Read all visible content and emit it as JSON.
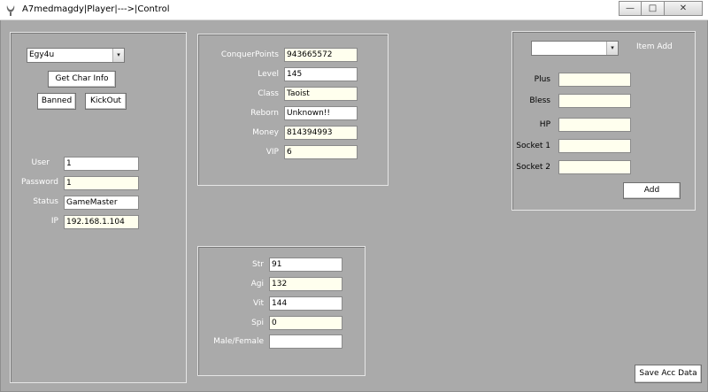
{
  "window": {
    "title": "A7medmagdy|Player|--->|Control",
    "minimize_glyph": "—",
    "maximize_glyph": "□",
    "close_glyph": "✕"
  },
  "account_panel": {
    "player_select": {
      "value": "Egy4u"
    },
    "get_char_info_label": "Get Char Info",
    "banned_label": "Banned",
    "kickout_label": "KickOut",
    "fields": {
      "user": {
        "label": "User",
        "value": "1"
      },
      "password": {
        "label": "Password",
        "value": "1"
      },
      "status": {
        "label": "Status",
        "value": "GameMaster"
      },
      "ip": {
        "label": "IP",
        "value": "192.168.1.104"
      }
    }
  },
  "char_panel": {
    "conquer_points": {
      "label": "ConquerPoints",
      "value": "943665572"
    },
    "level": {
      "label": "Level",
      "value": "145"
    },
    "class": {
      "label": "Class",
      "value": "Taoist"
    },
    "reborn": {
      "label": "Reborn",
      "value": "Unknown!!"
    },
    "money": {
      "label": "Money",
      "value": "814394993"
    },
    "vip": {
      "label": "VIP",
      "value": "6"
    }
  },
  "stats_panel": {
    "str": {
      "label": "Str",
      "value": "91"
    },
    "agi": {
      "label": "Agi",
      "value": "132"
    },
    "vit": {
      "label": "Vit",
      "value": "144"
    },
    "spi": {
      "label": "Spi",
      "value": "0"
    },
    "gender": {
      "label": "Male/Female",
      "value": ""
    }
  },
  "item_panel": {
    "item_select": {
      "value": ""
    },
    "item_add_label": "Item Add",
    "plus": {
      "label": "Plus",
      "value": ""
    },
    "bless": {
      "label": "Bless",
      "value": ""
    },
    "hp": {
      "label": "HP",
      "value": ""
    },
    "socket1": {
      "label": "Socket 1",
      "value": ""
    },
    "socket2": {
      "label": "Socket 2",
      "value": ""
    },
    "add_label": "Add"
  },
  "save_acc_data_label": "Save Acc Data",
  "colors": {
    "background": "#aaaaaa",
    "field_cream": "#ffffee",
    "field_white": "#ffffff",
    "label_white": "#ffffff"
  },
  "icons": {
    "app_icon": "app-logo-icon",
    "combo_arrow": "▾"
  }
}
